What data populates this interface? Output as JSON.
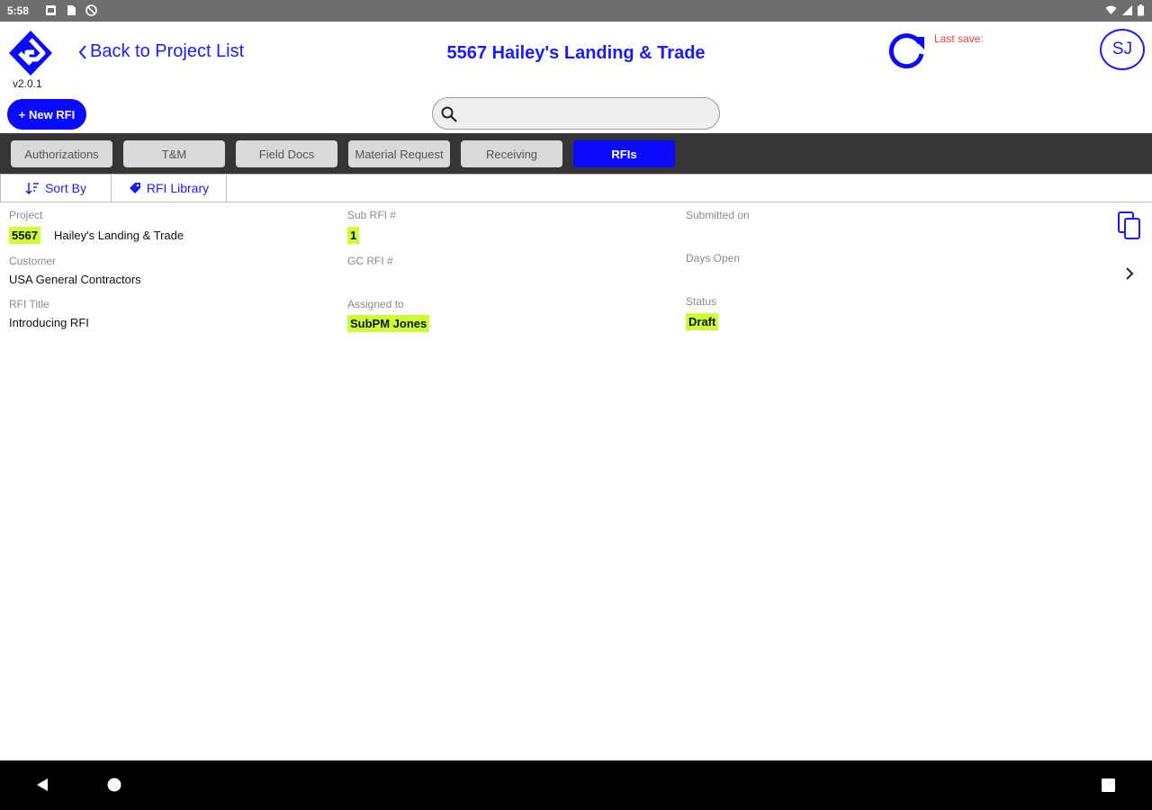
{
  "status_bar": {
    "time": "5:58"
  },
  "header": {
    "version": "v2.0.1",
    "back_label": "Back to Project List",
    "project_title": "5567 Hailey's Landing & Trade",
    "last_save": "Last save:",
    "avatar_initials": "SJ",
    "new_rfi_label": "+ New RFI",
    "search_placeholder": ""
  },
  "tabs": [
    {
      "label": "Authorizations"
    },
    {
      "label": "T&M"
    },
    {
      "label": "Field Docs"
    },
    {
      "label": "Material Request"
    },
    {
      "label": "Receiving"
    },
    {
      "label": "RFIs",
      "active": true
    }
  ],
  "subbar": {
    "sort_label": "Sort By",
    "library_label": "RFI Library"
  },
  "rfi": {
    "project_label": "Project",
    "project_number": "5567",
    "project_name": "Hailey's Landing & Trade",
    "customer_label": "Customer",
    "customer": "USA General Contractors",
    "title_label": "RFI Title",
    "title": "Introducing RFI",
    "sub_rfi_label": "Sub RFI #",
    "sub_rfi": "1",
    "gc_rfi_label": "GC RFI #",
    "gc_rfi": "",
    "assigned_label": "Assigned to",
    "assigned": "SubPM Jones",
    "submitted_label": "Submitted on",
    "submitted": "",
    "days_open_label": "Days Open",
    "days_open": "",
    "status_label": "Status",
    "status": "Draft"
  },
  "colors": {
    "accent": "#0a0aff",
    "highlight": "#ccff33",
    "tabbar": "#353535",
    "last_save": "#ff3b3b"
  }
}
